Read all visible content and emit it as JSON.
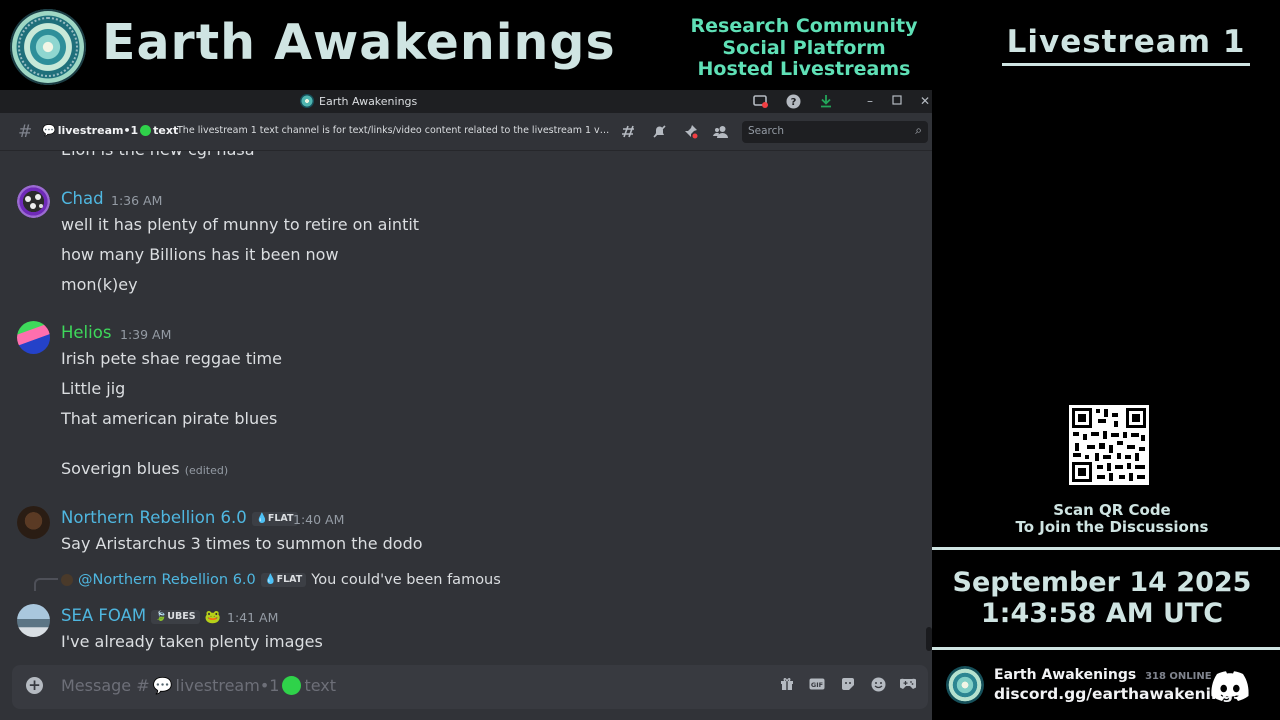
{
  "banner": {
    "brand": "Earth Awakenings",
    "taglines": [
      "Research Community",
      "Social Platform",
      "Hosted Livestreams"
    ]
  },
  "window": {
    "title": "Earth Awakenings"
  },
  "channel": {
    "name_prefix": "livestream•1",
    "name_suffix": "text",
    "topic": "The livestream 1 text channel is for text/links/video content related to the livestream 1 voice ...",
    "search_placeholder": "Search"
  },
  "messages": [
    {
      "partial_line": "Elon is the new cgi nasa"
    },
    {
      "author": "Chad",
      "author_color": "#4fb7e0",
      "time": "1:36 AM",
      "lines": [
        "well it has plenty of munny to retire on aintit",
        "how many Billions has it been now",
        "mon(k)ey"
      ]
    },
    {
      "author": "Helios",
      "author_color": "#3ed95b",
      "time": "1:39 AM",
      "lines": [
        "Irish pete shae reggae time",
        "Little jig",
        "That american pirate blues",
        "Soverign blues"
      ],
      "edited": "(edited)"
    },
    {
      "author": "Northern Rebellion 6.0",
      "author_color": "#4fb7e0",
      "tag": "FLAT",
      "time": "1:40 AM",
      "lines": [
        "Say Aristarchus 3 times to summon the dodo"
      ]
    },
    {
      "reply_to": "@Northern Rebellion 6.0",
      "reply_tag": "FLAT",
      "reply_text": "You could've been famous",
      "author": "SEA FOAM",
      "author_color": "#4fb7e0",
      "tag": "UBES",
      "time": "1:41 AM",
      "lines": [
        "I've already taken plenty images"
      ]
    }
  ],
  "composer": {
    "placeholder_prefix": "Message #",
    "placeholder_channel": "livestream•1",
    "placeholder_suffix": "text"
  },
  "right_panel": {
    "livestream_title": "Livestream 1",
    "qr_caption_1": "Scan QR Code",
    "qr_caption_2": "To Join the Discussions",
    "date": "September 14 2025",
    "time": "1:43:58 AM UTC",
    "server_name": "Earth Awakenings",
    "online": "318 ONLINE",
    "invite": "discord.gg/earthawakenings"
  }
}
